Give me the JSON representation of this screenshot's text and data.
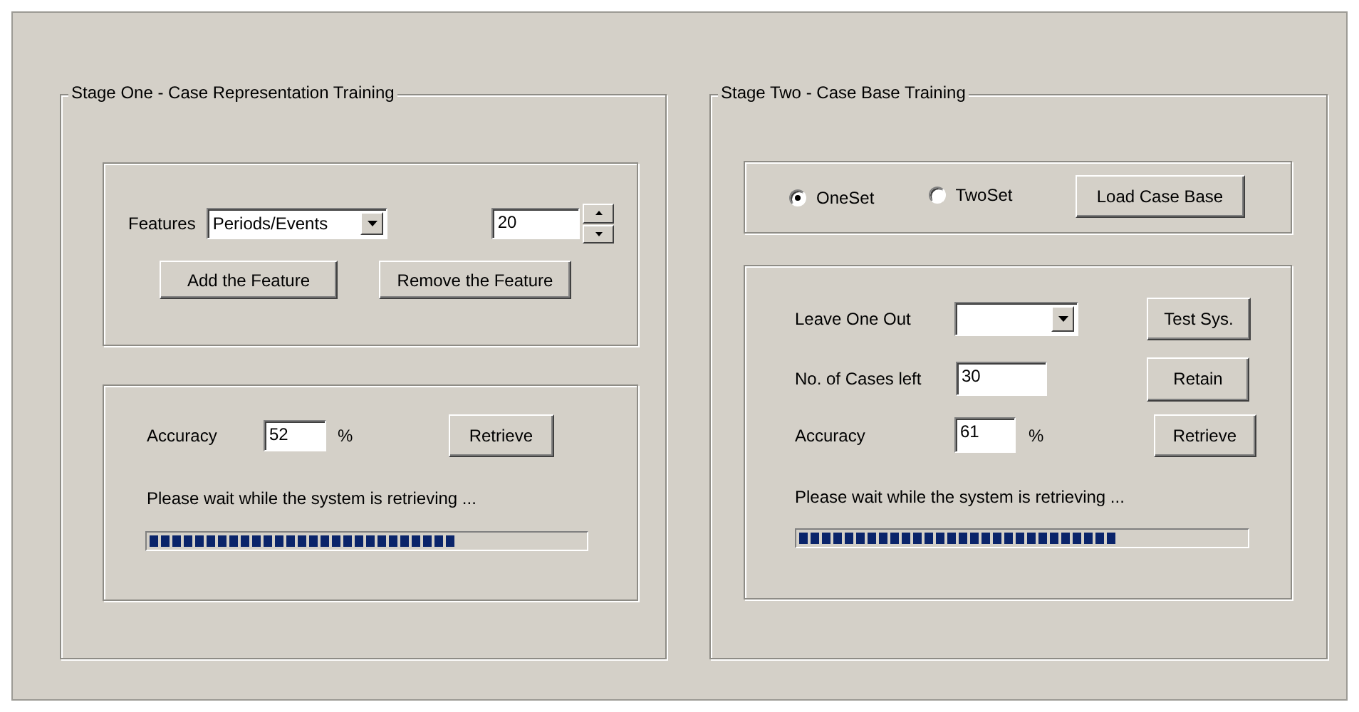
{
  "stage_one": {
    "title": "Stage One - Case Representation Training",
    "features": {
      "label": "Features",
      "value": "Periods/Events",
      "count": "20"
    },
    "feature_buttons": [
      "Add the Feature",
      "Remove the Feature"
    ],
    "accuracy": {
      "label": "Accuracy",
      "value": "52",
      "unit": "%"
    },
    "retrieve_button": "Retrieve",
    "status": "Please wait while the system is retrieving ...",
    "progress": {
      "level": 0.7
    }
  },
  "stage_two": {
    "title": "Stage Two - Case Base Training",
    "sets": [
      {
        "label": "OneSet",
        "selected": true
      },
      {
        "label": "TwoSet",
        "selected": false
      }
    ],
    "load_button": "Load Case Base",
    "leave_one_out": {
      "label": "Leave One Out"
    },
    "test_button": "Test Sys.",
    "cases_left": {
      "label": "No. of Cases left",
      "value": "30"
    },
    "retain_button": "Retain",
    "accuracy": {
      "label": "Accuracy",
      "value": "61",
      "unit": "%"
    },
    "retrieve_button": "Retrieve",
    "status": "Please wait while the system is retrieving ...",
    "progress": {
      "level": 0.71
    }
  }
}
